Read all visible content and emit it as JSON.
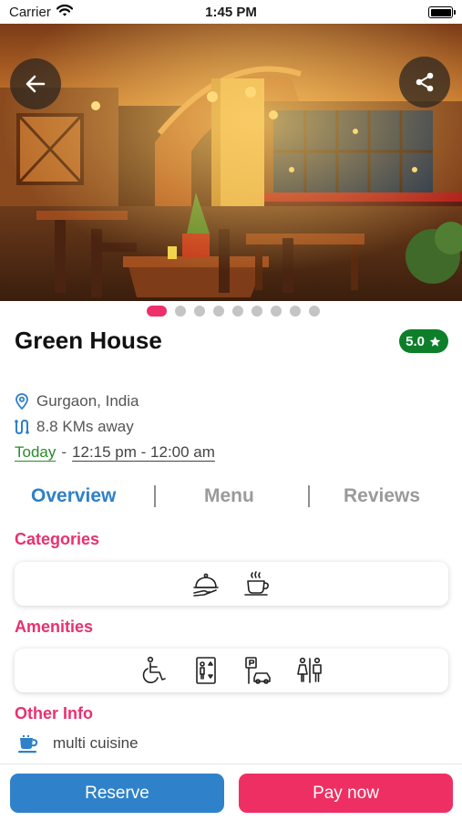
{
  "status_bar": {
    "carrier": "Carrier",
    "time": "1:45 PM"
  },
  "hero": {
    "photo_count": 9,
    "active_index": 0
  },
  "restaurant": {
    "name": "Green House",
    "rating": "5.0",
    "location": "Gurgaon, India",
    "distance": "8.8 KMs away",
    "day_label": "Today",
    "separator": "-",
    "hours": "12:15 pm - 12:00 am"
  },
  "tabs": [
    {
      "label": "Overview",
      "active": true
    },
    {
      "label": "Menu",
      "active": false
    },
    {
      "label": "Reviews",
      "active": false
    }
  ],
  "sections": {
    "categories_title": "Categories",
    "amenities_title": "Amenities",
    "other_info_title": "Other Info"
  },
  "categories": [
    "food-serving-icon",
    "coffee-cup-icon"
  ],
  "amenities": [
    "wheelchair-access-icon",
    "elevator-icon",
    "parking-icon",
    "restroom-icon"
  ],
  "other_info": {
    "item": "multi cuisine",
    "icon": "coffee-cup-icon"
  },
  "actions": {
    "reserve": "Reserve",
    "pay_now": "Pay now"
  },
  "colors": {
    "accent_blue": "#2f80c8",
    "accent_pink": "#e8316e",
    "rating_green": "#0d7f2a",
    "today_green": "#2a8a2a",
    "reserve_button": "#2f82c9",
    "pay_button": "#ee2f63"
  }
}
